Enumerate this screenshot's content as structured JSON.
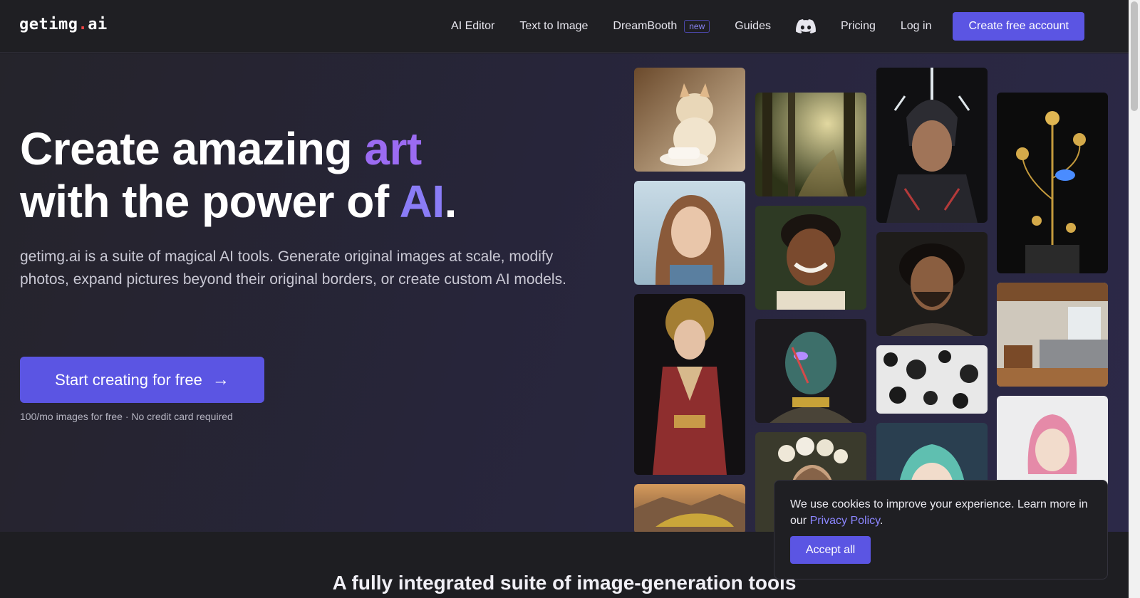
{
  "nav": {
    "logo_main": "getimg",
    "logo_dot": ".",
    "logo_tld": "ai",
    "links": {
      "ai_editor": "AI Editor",
      "text_to_image": "Text to Image",
      "dreambooth": "DreamBooth",
      "dreambooth_badge": "new",
      "guides": "Guides",
      "pricing": "Pricing",
      "login": "Log in"
    },
    "cta": "Create free account",
    "discord_icon": "discord-icon"
  },
  "hero": {
    "title_line1_prefix": "Create amazing ",
    "title_line1_accent": "art",
    "title_line2_prefix": "with the power of ",
    "title_line2_accent": "AI",
    "title_line2_suffix": ".",
    "description": "getimg.ai is a suite of magical AI tools. Generate original images at scale, modify photos, expand pictures beyond their original borders, or create custom AI models.",
    "cta": "Start creating for free",
    "cta_arrow": "→",
    "note": "100/mo images for free · No credit card required"
  },
  "gallery": {
    "tiles": [
      {
        "name": "cat-teacup-image"
      },
      {
        "name": "young-woman-portrait-image"
      },
      {
        "name": "kimono-woman-image"
      },
      {
        "name": "sports-car-image"
      },
      {
        "name": "forest-sunlight-image"
      },
      {
        "name": "smiling-man-portrait-image"
      },
      {
        "name": "cyborg-woman-image"
      },
      {
        "name": "flower-crown-woman-image"
      },
      {
        "name": "armored-warrior-image"
      },
      {
        "name": "bearded-man-portrait-image"
      },
      {
        "name": "white-organic-pattern-image"
      },
      {
        "name": "anime-girl-image"
      },
      {
        "name": "golden-flower-sculpture-image"
      },
      {
        "name": "bedroom-interior-image"
      },
      {
        "name": "pink-hair-character-image"
      }
    ]
  },
  "section": {
    "title": "A fully integrated suite of image-generation tools"
  },
  "cookie": {
    "text": "We use cookies to improve your experience. Learn more in our ",
    "link": "Privacy Policy",
    "suffix": ".",
    "accept": "Accept all"
  }
}
